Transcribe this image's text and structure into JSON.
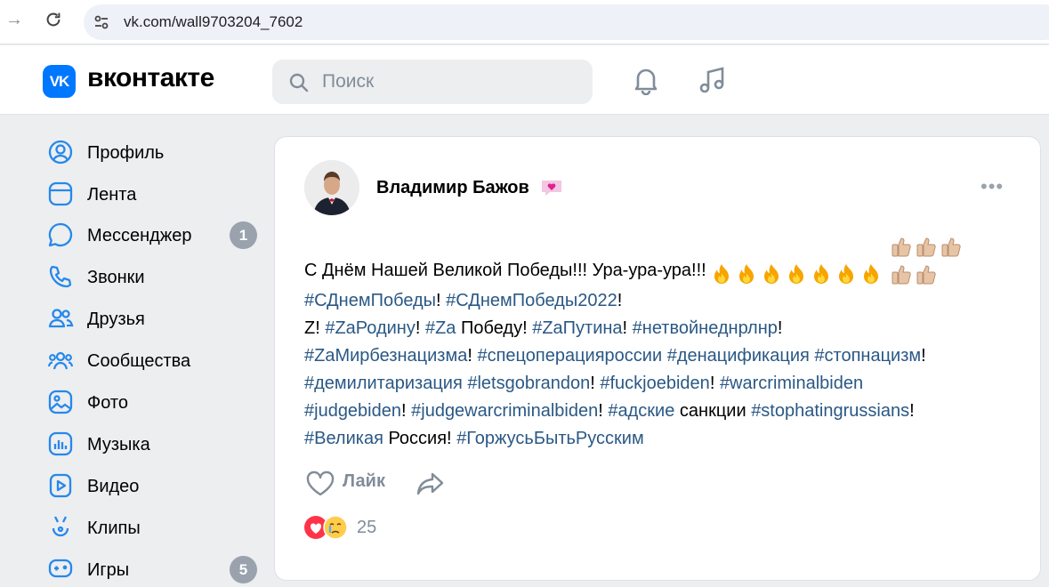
{
  "browser": {
    "url": "vk.com/wall9703204_7602"
  },
  "header": {
    "logo_mark": "VK",
    "logo_text": "вконтакте",
    "search_placeholder": "Поиск"
  },
  "sidebar": {
    "items": [
      {
        "label": "Профиль",
        "icon": "profile-icon"
      },
      {
        "label": "Лента",
        "icon": "feed-icon"
      },
      {
        "label": "Мессенджер",
        "icon": "messenger-icon",
        "badge": "1"
      },
      {
        "label": "Звонки",
        "icon": "phone-icon"
      },
      {
        "label": "Друзья",
        "icon": "friends-icon"
      },
      {
        "label": "Сообщества",
        "icon": "communities-icon"
      },
      {
        "label": "Фото",
        "icon": "photo-icon"
      },
      {
        "label": "Музыка",
        "icon": "music-icon"
      },
      {
        "label": "Видео",
        "icon": "video-icon"
      },
      {
        "label": "Клипы",
        "icon": "clips-icon"
      },
      {
        "label": "Игры",
        "icon": "games-icon",
        "badge": "5"
      }
    ]
  },
  "post": {
    "author": "Владимир Бажов",
    "text_line1": "С Днём Нашей Великой Победы!!! Ура-ура-ура!!!",
    "tags": {
      "t1": "#СДнемПобеды",
      "t2": "#СДнемПобеды2022",
      "t3": "#ZaРодину",
      "t4": "#Za",
      "t5": "#ZaПутина",
      "t6": "#нетвойнеднрлнр",
      "t7": "#ZaМирбезнацизма",
      "t8": "#спецоперацияроссии",
      "t9": "#денацификация",
      "t10": "#стопнацизм",
      "t11": "#демилитаризация",
      "t12": "#letsgobrandon",
      "t13": "#fuckjoebiden",
      "t14": "#warcriminalbiden",
      "t15": "#judgebiden",
      "t16": "#judgewarcriminalbiden",
      "t17": "#адские",
      "t18": "#stophatingrussians",
      "t19": "#Великая",
      "t20": "#ГоржусьБытьРусским"
    },
    "plain": {
      "excl": "!",
      "z": "Z!",
      "pobedu": "Победу!",
      "sanktsii": "санкции",
      "rossiya": "Россия!"
    },
    "like_label": "Лайк",
    "reaction_count": "25"
  },
  "colors": {
    "accent": "#2688eb",
    "link": "#2a5885",
    "muted": "#818c99",
    "vk_blue": "#0077ff"
  }
}
